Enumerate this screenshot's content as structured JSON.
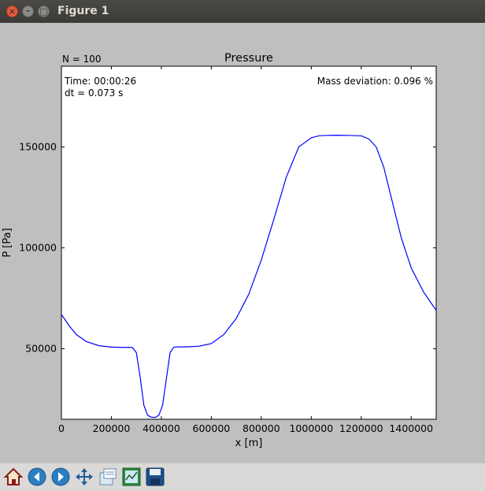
{
  "window": {
    "title": "Figure 1"
  },
  "annotations": {
    "n_label": "N = 100",
    "time": "Time: 00:00:26",
    "dt": "dt = 0.073 s",
    "mass": "Mass deviation: 0.096 %"
  },
  "chart_data": {
    "type": "line",
    "title": "Pressure",
    "xlabel": "x [m]",
    "ylabel": "P [Pa]",
    "xlim": [
      0,
      1500000
    ],
    "ylim": [
      15000,
      190000
    ],
    "grid": false,
    "x_ticks": [
      0,
      200000,
      400000,
      600000,
      800000,
      1000000,
      1200000,
      1400000
    ],
    "x_tick_labels": [
      "0",
      "200000",
      "400000",
      "600000",
      "800000",
      "1000000",
      "1200000",
      "1400000"
    ],
    "y_ticks": [
      50000,
      100000,
      150000
    ],
    "y_tick_labels": [
      "50000",
      "100000",
      "150000"
    ],
    "series": [
      {
        "color": "#0000ff",
        "x": [
          0,
          30000,
          60000,
          100000,
          150000,
          200000,
          250000,
          270000,
          285000,
          300000,
          315000,
          330000,
          345000,
          360000,
          375000,
          390000,
          405000,
          420000,
          435000,
          450000,
          470000,
          500000,
          550000,
          600000,
          650000,
          700000,
          750000,
          800000,
          850000,
          900000,
          950000,
          1000000,
          1030000,
          1060000,
          1100000,
          1150000,
          1200000,
          1230000,
          1260000,
          1290000,
          1320000,
          1360000,
          1400000,
          1450000,
          1500000
        ],
        "y": [
          67000,
          61500,
          57000,
          53500,
          51500,
          50800,
          50600,
          50700,
          50500,
          48000,
          36000,
          22000,
          17000,
          16000,
          15900,
          17000,
          22000,
          35000,
          48000,
          50800,
          50900,
          50900,
          51200,
          52500,
          57000,
          65000,
          77000,
          94000,
          114000,
          135000,
          150000,
          154500,
          155500,
          155700,
          155800,
          155700,
          155500,
          154000,
          150000,
          140000,
          125000,
          105000,
          90000,
          78000,
          69000
        ]
      }
    ]
  },
  "toolbar": {
    "items": [
      "home-icon",
      "back-icon",
      "forward-icon",
      "pan-icon",
      "zoom-icon",
      "subplots-icon",
      "save-icon"
    ]
  }
}
